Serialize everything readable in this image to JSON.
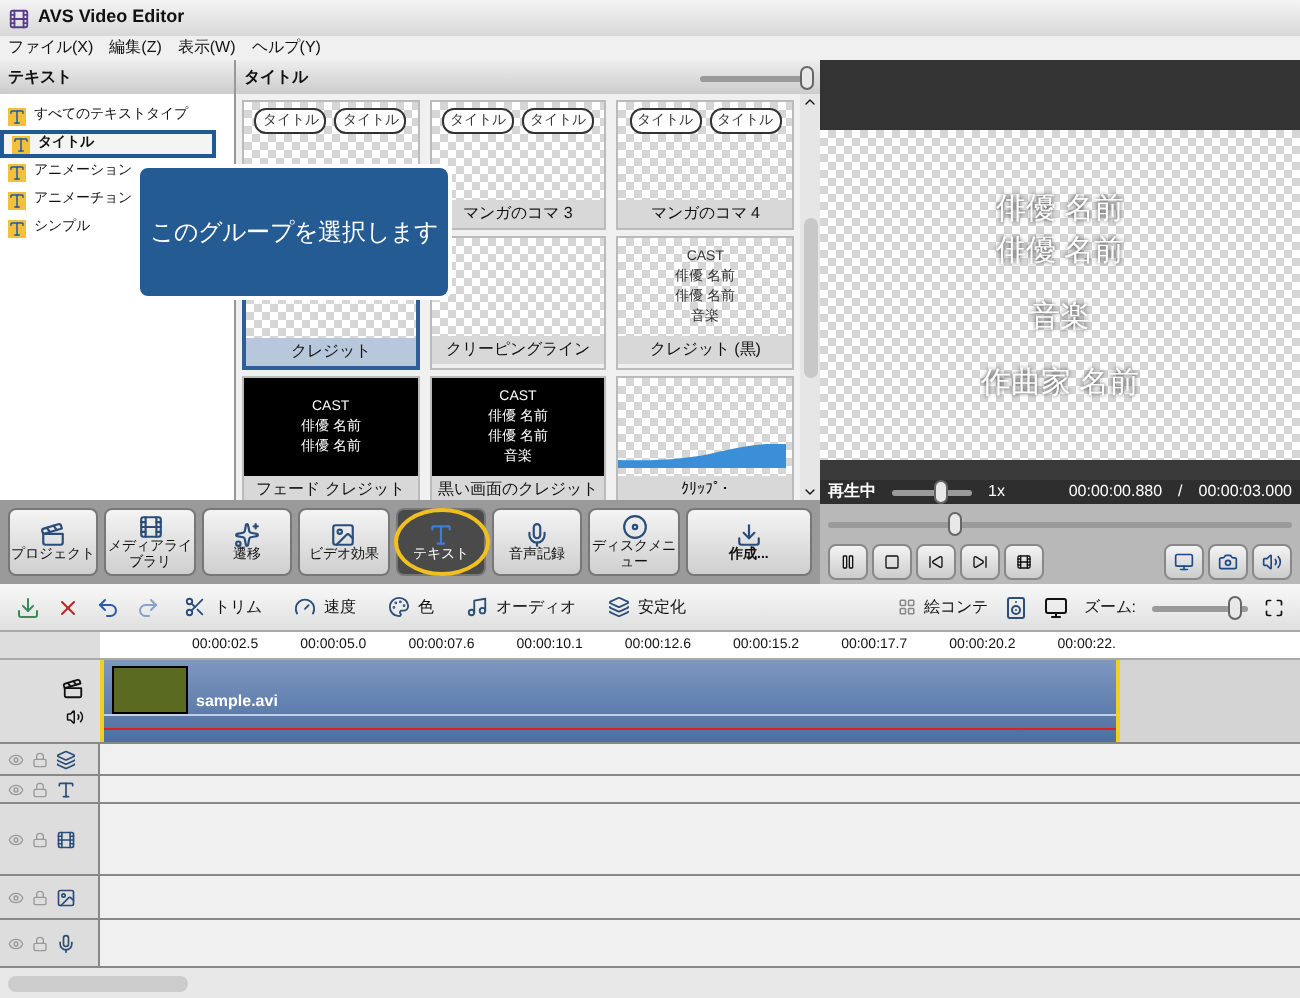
{
  "window": {
    "title": "AVS Video Editor"
  },
  "menu": [
    "ファイル(X)",
    "編集(Z)",
    "表示(W)",
    "ヘルプ(Y)"
  ],
  "categories": {
    "header": "テキスト",
    "items": [
      {
        "label": "すべてのテキストタイプ",
        "selected": false
      },
      {
        "label": "タイトル",
        "selected": true
      },
      {
        "label": "アニメーション",
        "selected": false
      },
      {
        "label": "アニメーチョン",
        "selected": false
      },
      {
        "label": "シンプル",
        "selected": false
      }
    ]
  },
  "callout": {
    "text": "このグループを選択します"
  },
  "gallery": {
    "header": "タイトル",
    "size_slider": {
      "level": 0.95
    },
    "items": [
      {
        "kind": "bubbles",
        "lines": [
          "タイトル",
          "タイトル"
        ],
        "selected": false
      },
      {
        "kind": "bubbles",
        "lines": [
          "タイトル",
          "タイトル"
        ],
        "caption": "マンガのコマ 3",
        "selected": false
      },
      {
        "kind": "bubbles",
        "lines": [
          "タイトル",
          "タイトル"
        ],
        "caption": "マンガのコマ 4",
        "selected": false
      },
      {
        "kind": "checker",
        "caption": "クレジット",
        "selected": true
      },
      {
        "kind": "checker",
        "caption": "クリーピングライン",
        "selected": false
      },
      {
        "kind": "checker",
        "lines": [
          "CAST",
          "俳優 名前",
          "俳優 名前",
          "音楽"
        ],
        "caption": "クレジット (黒)",
        "selected": false
      },
      {
        "kind": "black",
        "lines": [
          "CAST",
          "俳優 名前",
          "俳優 名前"
        ],
        "caption": "フェード クレジット",
        "selected": false
      },
      {
        "kind": "black",
        "lines": [
          "CAST",
          "俳優 名前",
          "俳優 名前",
          "音楽"
        ],
        "caption": "黒い画面のクレジット",
        "selected": false
      },
      {
        "kind": "wave",
        "caption": "ｸﾘｯﾌﾟ･",
        "selected": false
      }
    ]
  },
  "preview": {
    "lines": [
      "俳優 名前",
      "俳優 名前",
      "音楽",
      "作曲家 名前"
    ],
    "status": "再生中",
    "speed_slider": {
      "level": 0.6
    },
    "speed": "1x",
    "time": "00:00:00.880",
    "separator": "/",
    "duration": "00:00:03.000",
    "seek_slider": {
      "level": 0.27
    }
  },
  "tools": [
    {
      "label": "プロジェクト",
      "selected": false
    },
    {
      "label": "メディアライブラリ",
      "selected": false
    },
    {
      "label": "遷移",
      "selected": false
    },
    {
      "label": "ビデオ効果",
      "selected": false
    },
    {
      "label": "テキスト",
      "selected": true
    },
    {
      "label": "音声記録",
      "selected": false
    },
    {
      "label": "ディスクメニュー",
      "selected": false
    },
    {
      "label": "作成...",
      "selected": false
    }
  ],
  "timeline": {
    "actions": [
      "トリム",
      "速度",
      "色",
      "オーディオ",
      "安定化"
    ],
    "storyboard": "絵コンテ",
    "zoom_label": "ズーム:",
    "zoom_slider": {
      "level": 0.85
    },
    "ruler": [
      "00:00:02.5",
      "00:00:05.0",
      "00:00:07.6",
      "00:00:10.1",
      "00:00:12.6",
      "00:00:15.2",
      "00:00:17.7",
      "00:00:20.2",
      "00:00:22."
    ],
    "clip": "sample.avi"
  }
}
